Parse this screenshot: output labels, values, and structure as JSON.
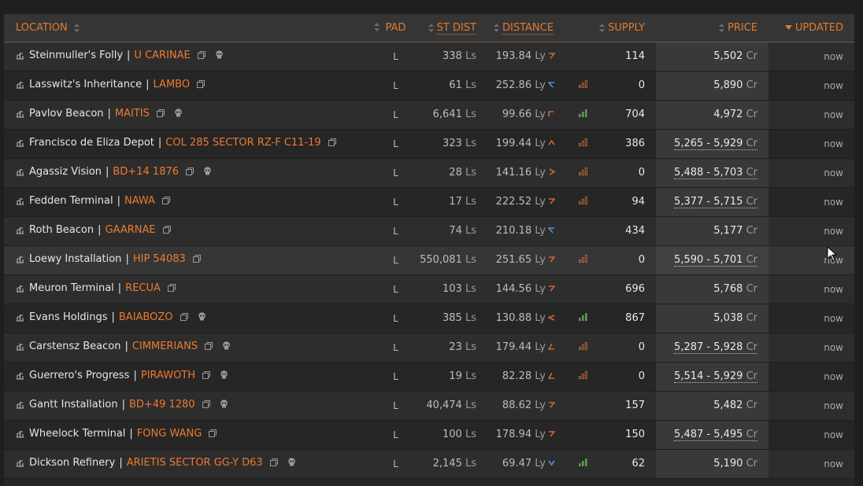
{
  "headers": {
    "location": "LOCATION",
    "pad": "PAD",
    "st_dist": "ST DIST",
    "distance": "DISTANCE",
    "supply": "SUPPLY",
    "price": "PRICE",
    "updated": "UPDATED"
  },
  "rows": [
    {
      "station": "Steinmuller's Folly",
      "system": "U CARINAE",
      "skull": true,
      "pad": "L",
      "st_dist": "338",
      "st_unit": "Ls",
      "distance": "193.84",
      "dist_unit": "Ly",
      "dir": "ur",
      "demand": 0,
      "supply": "114",
      "price": "5,502",
      "cr": "Cr",
      "range": false,
      "updated": "now"
    },
    {
      "station": "Lasswitz's Inheritance",
      "system": "LAMBO",
      "skull": false,
      "pad": "L",
      "st_dist": "61",
      "st_unit": "Ls",
      "distance": "252.86",
      "dist_unit": "Ly",
      "dir": "ul",
      "demand": 1,
      "supply": "0",
      "price": "5,890",
      "cr": "Cr",
      "range": false,
      "updated": "now"
    },
    {
      "station": "Pavlov Beacon",
      "system": "MAITIS",
      "skull": true,
      "pad": "L",
      "st_dist": "6,641",
      "st_unit": "Ls",
      "distance": "99.66",
      "dist_unit": "Ly",
      "dir": "ul2",
      "demand": 3,
      "supply": "704",
      "price": "4,972",
      "cr": "Cr",
      "range": false,
      "updated": "now"
    },
    {
      "station": "Francisco de Eliza Depot",
      "system": "COL 285 SECTOR RZ-F C11-19",
      "skull": false,
      "pad": "L",
      "st_dist": "323",
      "st_unit": "Ls",
      "distance": "199.44",
      "dist_unit": "Ly",
      "dir": "up",
      "demand": 1,
      "supply": "386",
      "price": "5,265 - 5,929",
      "cr": "Cr",
      "range": true,
      "updated": "now"
    },
    {
      "station": "Agassiz Vision",
      "system": "BD+14 1876",
      "skull": true,
      "pad": "L",
      "st_dist": "28",
      "st_unit": "Ls",
      "distance": "141.16",
      "dist_unit": "Ly",
      "dir": "right",
      "demand": 1,
      "supply": "0",
      "price": "5,488 - 5,703",
      "cr": "Cr",
      "range": true,
      "updated": "now"
    },
    {
      "station": "Fedden Terminal",
      "system": "NAWA",
      "skull": false,
      "pad": "L",
      "st_dist": "17",
      "st_unit": "Ls",
      "distance": "222.52",
      "dist_unit": "Ly",
      "dir": "ur",
      "demand": 1,
      "supply": "94",
      "price": "5,377 - 5,715",
      "cr": "Cr",
      "range": true,
      "updated": "now"
    },
    {
      "station": "Roth Beacon",
      "system": "GAARNAE",
      "skull": false,
      "pad": "L",
      "st_dist": "74",
      "st_unit": "Ls",
      "distance": "210.18",
      "dist_unit": "Ly",
      "dir": "ul",
      "demand": 0,
      "supply": "434",
      "price": "5,177",
      "cr": "Cr",
      "range": false,
      "updated": "now"
    },
    {
      "station": "Loewy Installation",
      "system": "HIP 54083",
      "skull": false,
      "pad": "L",
      "st_dist": "550,081",
      "st_unit": "Ls",
      "distance": "251.65",
      "dist_unit": "Ly",
      "dir": "ur",
      "demand": 1,
      "supply": "0",
      "price": "5,590 - 5,701",
      "cr": "Cr",
      "range": true,
      "updated": "now",
      "hover": true
    },
    {
      "station": "Meuron Terminal",
      "system": "RECUA",
      "skull": false,
      "pad": "L",
      "st_dist": "103",
      "st_unit": "Ls",
      "distance": "144.56",
      "dist_unit": "Ly",
      "dir": "ur",
      "demand": 0,
      "supply": "696",
      "price": "5,768",
      "cr": "Cr",
      "range": false,
      "updated": "now"
    },
    {
      "station": "Evans Holdings",
      "system": "BAIABOZO",
      "skull": true,
      "pad": "L",
      "st_dist": "385",
      "st_unit": "Ls",
      "distance": "130.88",
      "dist_unit": "Ly",
      "dir": "left",
      "demand": 3,
      "supply": "867",
      "price": "5,038",
      "cr": "Cr",
      "range": false,
      "updated": "now"
    },
    {
      "station": "Carstensz Beacon",
      "system": "CIMMERIANS",
      "skull": true,
      "pad": "L",
      "st_dist": "23",
      "st_unit": "Ls",
      "distance": "179.44",
      "dist_unit": "Ly",
      "dir": "dl",
      "demand": 1,
      "supply": "0",
      "price": "5,287 - 5,928",
      "cr": "Cr",
      "range": true,
      "updated": "now"
    },
    {
      "station": "Guerrero's Progress",
      "system": "PIRAWOTH",
      "skull": true,
      "pad": "L",
      "st_dist": "19",
      "st_unit": "Ls",
      "distance": "82.28",
      "dist_unit": "Ly",
      "dir": "dl",
      "demand": 1,
      "supply": "0",
      "price": "5,514 - 5,929",
      "cr": "Cr",
      "range": true,
      "updated": "now"
    },
    {
      "station": "Gantt Installation",
      "system": "BD+49 1280",
      "skull": true,
      "pad": "L",
      "st_dist": "40,474",
      "st_unit": "Ls",
      "distance": "88.62",
      "dist_unit": "Ly",
      "dir": "ur",
      "demand": 0,
      "supply": "157",
      "price": "5,482",
      "cr": "Cr",
      "range": false,
      "updated": "now"
    },
    {
      "station": "Wheelock Terminal",
      "system": "FONG WANG",
      "skull": false,
      "pad": "L",
      "st_dist": "100",
      "st_unit": "Ls",
      "distance": "178.94",
      "dist_unit": "Ly",
      "dir": "ur",
      "demand": 0,
      "supply": "150",
      "price": "5,487 - 5,495",
      "cr": "Cr",
      "range": true,
      "updated": "now"
    },
    {
      "station": "Dickson Refinery",
      "system": "ARIETIS SECTOR GG-Y D63",
      "skull": true,
      "pad": "L",
      "st_dist": "2,145",
      "st_unit": "Ls",
      "distance": "69.47",
      "dist_unit": "Ly",
      "dir": "down",
      "demand": 3,
      "supply": "62",
      "price": "5,190",
      "cr": "Cr",
      "range": false,
      "updated": "now"
    }
  ],
  "colors": {
    "accent": "#e07b2e",
    "system": "#ee7a2f",
    "demand_low": "#c0643a",
    "demand_high": "#5d9a50",
    "dir_orange": "#d5613a",
    "dir_blue": "#5b8fd1"
  },
  "icons": {
    "station": "station-icon",
    "copy": "copy-icon",
    "skull": "skull-icon",
    "sort": "sort-icon",
    "direction": "direction-arrow-icon",
    "demand": "demand-bars-icon"
  }
}
